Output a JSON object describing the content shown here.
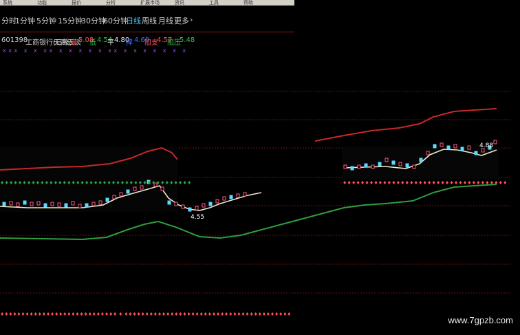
{
  "toolbar": {
    "items": [
      "系统",
      "功能",
      "报价",
      "分析",
      "扩展市场",
      "资讯",
      "工具",
      "帮助"
    ]
  },
  "periods": {
    "items": [
      "分时",
      "1分钟",
      "5分钟",
      "15分钟",
      "30分钟",
      "60分钟",
      "日线",
      "周线",
      "月线",
      "更多"
    ],
    "active_index": 6,
    "more_arrow": "›"
  },
  "stock": {
    "code": "601398",
    "name": "工商银行(日线)",
    "indicator": "天高云淡",
    "high_label": "高",
    "high_value": "5.08",
    "low_label": "低",
    "low_value": "4.54",
    "mid_label": "平",
    "mid_value": "4.80",
    "support_label": "撑",
    "support_value": "4.60",
    "resist_label": "阻支",
    "resist_value": "4.57",
    "pressure_label": "阻压",
    "pressure_value": "5.48",
    "row2_marks": "xxx x x xx x x x x x xx x x x x x x x"
  },
  "chart": {
    "price_label_low": "4.55",
    "price_label_high": "4.88",
    "buy_marks_left": "♦♦♦♦♦♦♦♦♦♦♦♦♦♦♦♦♦♦♦♦♦♦♦♦♦♦♦♦♦♦♦♦♦♦♦♦♦♦♦♦♦♦♦",
    "sell_marks_right": "♦♦♦♦♦♦♦♦♦♦♦♦♦♦♦♦♦♦♦♦♦♦♦♦♦♦♦♦♦♦♦♦♦♦♦♦♦",
    "bottom_marks": "♦♦♦♦♦♦♦♦♦♦♦♦♦♦♦♦♦♦♦♦♦♦♦♦♦♦♦♦ ♦ ♦♦♦♦♦♦♦♦♦♦♦♦♦♦♦♦♦♦♦♦♦♦♦♦♦♦♦♦♦♦♦♦♦♦♦♦♦♦♦♦",
    "colors": {
      "upper_band": "#c62828",
      "lower_band": "#2e9e3e",
      "mid_line": "#f0e8c8",
      "grid": "#7a1010",
      "buy": "#2ea043",
      "sell": "#ff4f5a"
    }
  },
  "watermark": "www.7gpzb.com"
}
